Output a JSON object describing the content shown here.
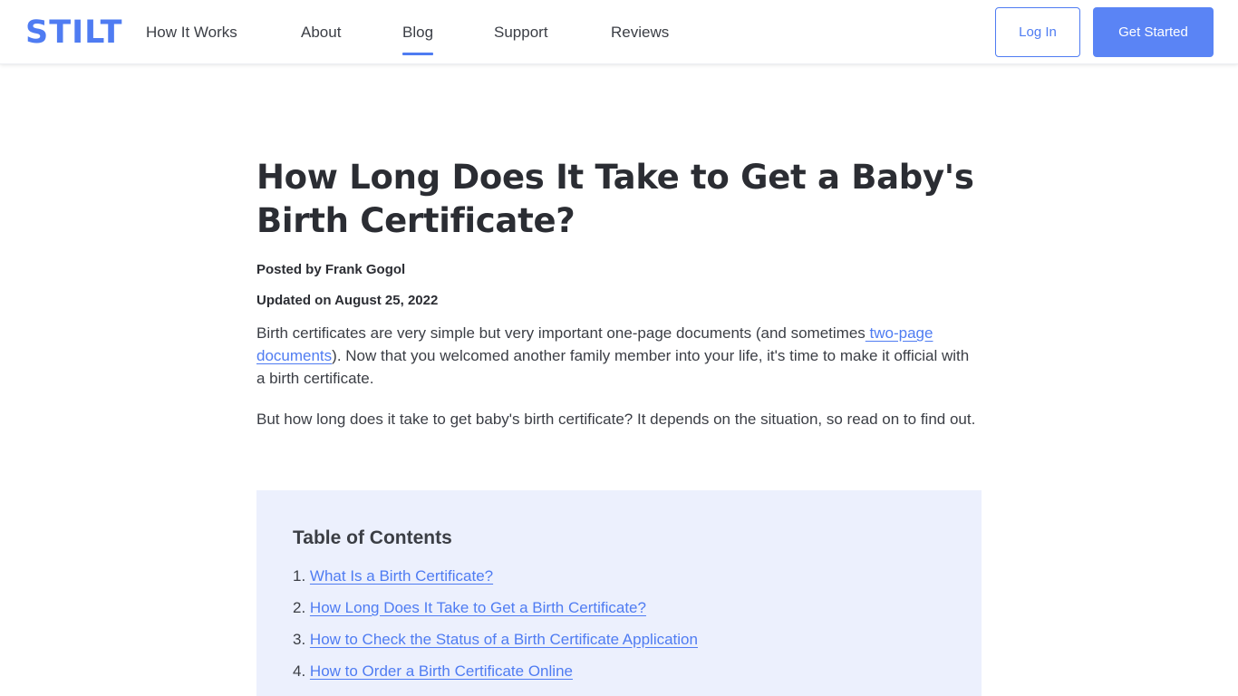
{
  "header": {
    "logo": "STILT",
    "nav": [
      {
        "label": "How It Works",
        "active": false
      },
      {
        "label": "About",
        "active": false
      },
      {
        "label": "Blog",
        "active": true
      },
      {
        "label": "Support",
        "active": false
      },
      {
        "label": "Reviews",
        "active": false
      }
    ],
    "login_label": "Log In",
    "get_started_label": "Get Started"
  },
  "article": {
    "title": "How Long Does It Take to Get a Baby's Birth Certificate?",
    "posted_by": "Posted by Frank Gogol",
    "updated_on": "Updated on August 25, 2022",
    "para1": {
      "before": "Birth certificates are very simple but very important one-page documents (and sometimes",
      "link": " two-page documents",
      "after": "). Now that you welcomed another family member into your life, it's time to make it official with a birth certificate."
    },
    "para2": "But how long does it take to get baby's birth certificate? It depends on the situation, so read on to find out."
  },
  "toc": {
    "title": "Table of Contents",
    "items": [
      {
        "num": "1.",
        "label": "What Is a Birth Certificate?"
      },
      {
        "num": "2.",
        "label": "How Long Does It Take to Get a Birth Certificate?"
      },
      {
        "num": "3.",
        "label": "How to Check the Status of a Birth Certificate Application"
      },
      {
        "num": "4.",
        "label": "How to Order a Birth Certificate Online"
      }
    ]
  },
  "colors": {
    "accent": "#4f7cf2",
    "toc_background": "#ecf0fd",
    "text": "#2b2d33"
  }
}
